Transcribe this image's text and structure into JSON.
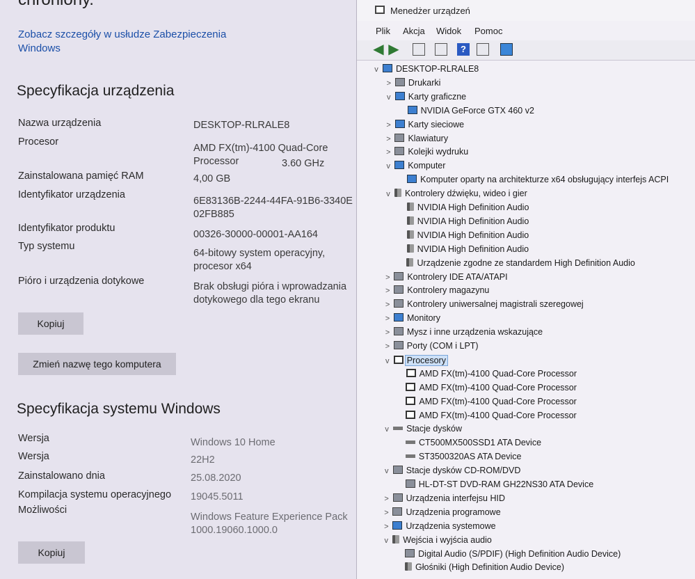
{
  "settings": {
    "clipped_title": "chroniony.",
    "security_link": "Zobacz szczegóły w usłudze Zabezpieczenia Windows",
    "device_spec_heading": "Specyfikacja urządzenia",
    "device_name_label": "Nazwa urządzenia",
    "device_name_value": "DESKTOP-RLRALE8",
    "processor_label": "Procesor",
    "processor_value": "AMD FX(tm)-4100 Quad-Core Processor",
    "processor_speed": "3.60 GHz",
    "ram_label": "Zainstalowana pamięć RAM",
    "ram_value": "4,00 GB",
    "device_id_label": "Identyfikator urządzenia",
    "device_id_value": "6E83136B-2244-44FA-91B6-3340E02FB885",
    "product_id_label": "Identyfikator produktu",
    "product_id_value": "00326-30000-00001-AA164",
    "system_type_label": "Typ systemu",
    "system_type_value": "64-bitowy system operacyjny, procesor x64",
    "pen_label": "Pióro i urządzenia dotykowe",
    "pen_value": "Brak obsługi pióra i wprowadzania dotykowego dla tego ekranu",
    "copy_button": "Kopiuj",
    "rename_button": "Zmień nazwę tego komputera",
    "windows_spec_heading": "Specyfikacja systemu Windows",
    "edition_label": "Wersja",
    "edition_value": "Windows 10 Home",
    "version_label": "Wersja",
    "version_value": "22H2",
    "installed_label": "Zainstalowano dnia",
    "installed_value": "25.08.2020",
    "build_label": "Kompilacja systemu operacyjnego",
    "build_value": "19045.5011",
    "experience_label": "Możliwości",
    "experience_value": "Windows Feature Experience Pack 1000.19060.1000.0",
    "copy_button_2": "Kopiuj"
  },
  "devmgr": {
    "title": "Menedżer urządzeń",
    "menu": [
      "Plik",
      "Akcja",
      "Widok",
      "Pomoc"
    ],
    "toolbar_icons": [
      "back-arrow-icon",
      "forward-arrow-icon",
      "properties-icon",
      "view-icon",
      "help-icon",
      "details-icon",
      "monitor-icon"
    ],
    "tree": [
      {
        "level": 0,
        "expand": "v",
        "icon": "pc",
        "text": "DESKTOP-RLRALE8"
      },
      {
        "level": 1,
        "expand": ">",
        "icon": "gray",
        "text": "Drukarki"
      },
      {
        "level": 1,
        "expand": "v",
        "icon": "gpu",
        "text": "Karty graficzne"
      },
      {
        "level": 2,
        "expand": "",
        "icon": "gpu",
        "text": "NVIDIA GeForce GTX 460 v2"
      },
      {
        "level": 1,
        "expand": ">",
        "icon": "pc",
        "text": "Karty sieciowe"
      },
      {
        "level": 1,
        "expand": ">",
        "icon": "gray",
        "text": "Klawiatury"
      },
      {
        "level": 1,
        "expand": ">",
        "icon": "gray",
        "text": "Kolejki wydruku"
      },
      {
        "level": 1,
        "expand": "v",
        "icon": "pc",
        "text": "Komputer"
      },
      {
        "level": 2,
        "expand": "",
        "icon": "pc",
        "text": "Komputer oparty na architekturze x64 obsługujący interfejs ACPI"
      },
      {
        "level": 1,
        "expand": "v",
        "icon": "snd",
        "text": "Kontrolery dźwięku, wideo i gier"
      },
      {
        "level": 2,
        "expand": "",
        "icon": "snd",
        "text": "NVIDIA High Definition Audio"
      },
      {
        "level": 2,
        "expand": "",
        "icon": "snd",
        "text": "NVIDIA High Definition Audio"
      },
      {
        "level": 2,
        "expand": "",
        "icon": "snd",
        "text": "NVIDIA High Definition Audio"
      },
      {
        "level": 2,
        "expand": "",
        "icon": "snd",
        "text": "NVIDIA High Definition Audio"
      },
      {
        "level": 2,
        "expand": "",
        "icon": "snd",
        "text": "Urządzenie zgodne ze standardem High Definition Audio"
      },
      {
        "level": 1,
        "expand": ">",
        "icon": "gray",
        "text": "Kontrolery IDE ATA/ATAPI"
      },
      {
        "level": 1,
        "expand": ">",
        "icon": "gray",
        "text": "Kontrolery magazynu"
      },
      {
        "level": 1,
        "expand": ">",
        "icon": "gray",
        "text": "Kontrolery uniwersalnej magistrali szeregowej"
      },
      {
        "level": 1,
        "expand": ">",
        "icon": "pc",
        "text": "Monitory"
      },
      {
        "level": 1,
        "expand": ">",
        "icon": "gray",
        "text": "Mysz i inne urządzenia wskazujące"
      },
      {
        "level": 1,
        "expand": ">",
        "icon": "gray",
        "text": "Porty (COM i LPT)"
      },
      {
        "level": 1,
        "expand": "v",
        "icon": "cpu",
        "text": "Procesory",
        "selected": true
      },
      {
        "level": 2,
        "expand": "",
        "icon": "cpu",
        "text": "AMD FX(tm)-4100 Quad-Core Processor"
      },
      {
        "level": 2,
        "expand": "",
        "icon": "cpu",
        "text": "AMD FX(tm)-4100 Quad-Core Processor"
      },
      {
        "level": 2,
        "expand": "",
        "icon": "cpu",
        "text": "AMD FX(tm)-4100 Quad-Core Processor"
      },
      {
        "level": 2,
        "expand": "",
        "icon": "cpu",
        "text": "AMD FX(tm)-4100 Quad-Core Processor"
      },
      {
        "level": 1,
        "expand": "v",
        "icon": "disk",
        "text": "Stacje dysków"
      },
      {
        "level": 2,
        "expand": "",
        "icon": "disk",
        "text": "CT500MX500SSD1 ATA Device"
      },
      {
        "level": 2,
        "expand": "",
        "icon": "disk",
        "text": "ST3500320AS ATA Device"
      },
      {
        "level": 1,
        "expand": "v",
        "icon": "gray",
        "text": "Stacje dysków CD-ROM/DVD"
      },
      {
        "level": 2,
        "expand": "",
        "icon": "gray",
        "text": "HL-DT-ST DVD-RAM GH22NS30 ATA Device"
      },
      {
        "level": 1,
        "expand": ">",
        "icon": "gray",
        "text": "Urządzenia interfejsu HID"
      },
      {
        "level": 1,
        "expand": ">",
        "icon": "gray",
        "text": "Urządzenia programowe"
      },
      {
        "level": 1,
        "expand": ">",
        "icon": "pc",
        "text": "Urządzenia systemowe"
      },
      {
        "level": 1,
        "expand": "v",
        "icon": "snd",
        "text": "Wejścia i wyjścia audio"
      },
      {
        "level": 2,
        "expand": "",
        "icon": "gray",
        "text": "Digital Audio (S/PDIF) (High Definition Audio Device)"
      },
      {
        "level": 2,
        "expand": "",
        "icon": "snd",
        "text": "Głośniki (High Definition Audio Device)"
      }
    ]
  }
}
